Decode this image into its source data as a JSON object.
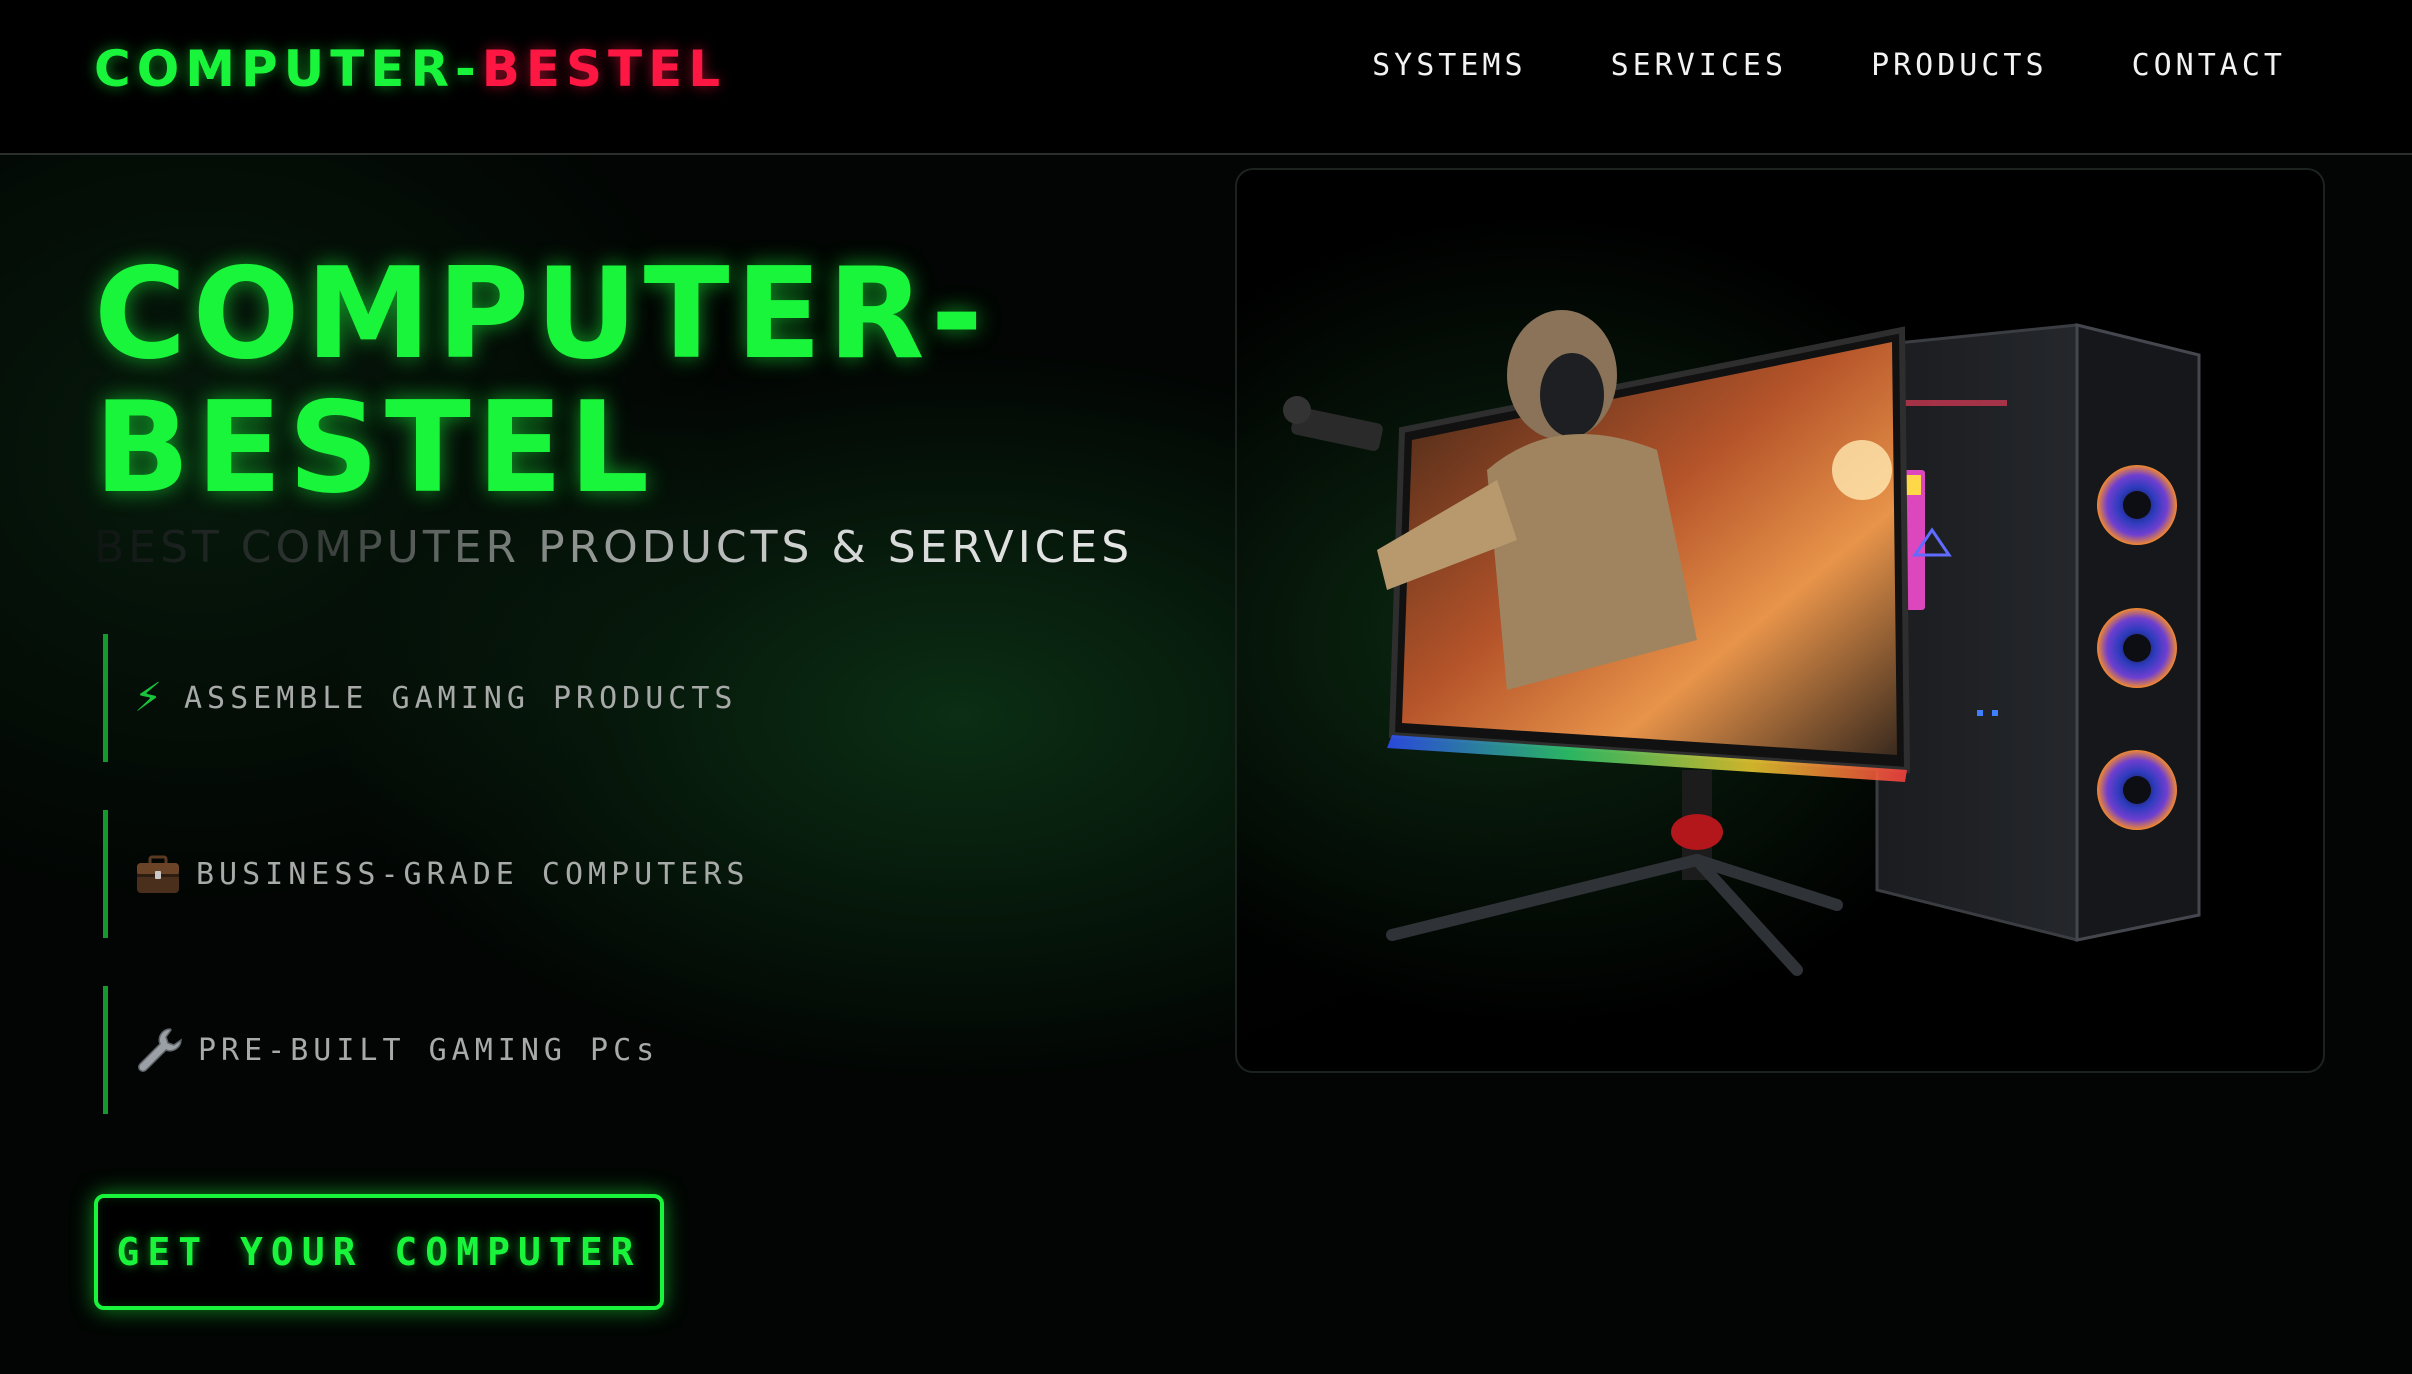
{
  "brand": {
    "part1": "COMPUTER-",
    "part2": "BESTEL",
    "color_primary": "#19f53a",
    "color_accent": "#ff1744"
  },
  "nav": {
    "items": [
      {
        "label": "SYSTEMS"
      },
      {
        "label": "SERVICES"
      },
      {
        "label": "PRODUCTS"
      },
      {
        "label": "CONTACT"
      }
    ]
  },
  "hero": {
    "title_line1": "COMPUTER-",
    "title_line2": "BESTEL",
    "subtitle": "BEST COMPUTER PRODUCTS & SERVICES",
    "features": [
      {
        "icon": "lightning-bolt-icon",
        "label": "ASSEMBLE GAMING PRODUCTS"
      },
      {
        "icon": "briefcase-icon",
        "label": "BUSINESS-GRADE COMPUTERS"
      },
      {
        "icon": "wrench-icon",
        "label": "PRE-BUILT GAMING PCs"
      }
    ],
    "cta_label": "GET YOUR COMPUTER",
    "bolt_glyph": "⚡"
  },
  "product_image": {
    "alt": "gaming-pc-with-monitor"
  }
}
